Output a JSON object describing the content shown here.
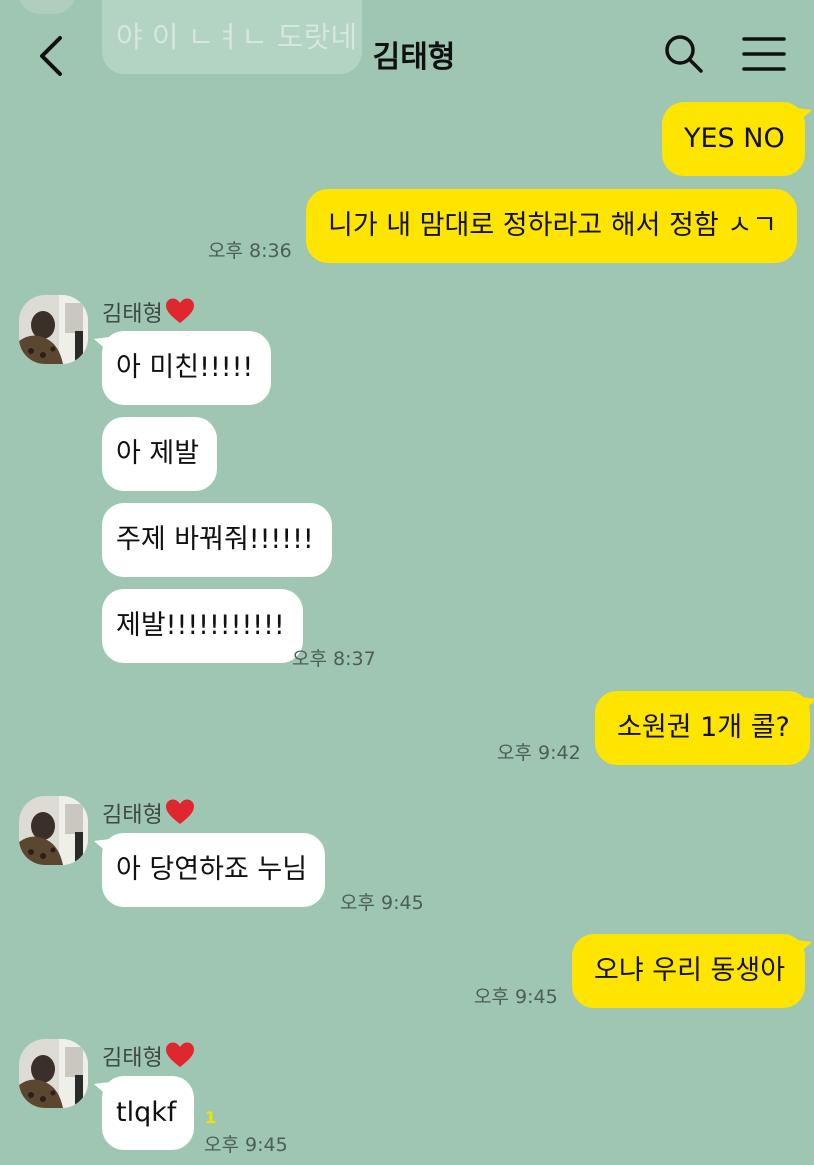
{
  "header": {
    "title": "김태형",
    "back_icon": "chevron-left-icon",
    "search_icon": "search-icon",
    "menu_icon": "menu-icon"
  },
  "previous_message_preview": "야 이 ㄴㅕㄴ 도랏네",
  "contact": {
    "name": "김태형"
  },
  "messages": [
    {
      "from": "me",
      "text": "YES NO"
    },
    {
      "from": "me",
      "text": "니가 내 맘대로 정하라고 해서 정함 ㅅㄱ",
      "time": "오후 8:36"
    },
    {
      "from": "them",
      "text": "아 미친!!!!!"
    },
    {
      "from": "them",
      "text": "아 제발"
    },
    {
      "from": "them",
      "text": "주제 바꿔줘!!!!!!"
    },
    {
      "from": "them",
      "text": "제발!!!!!!!!!!!",
      "time": "오후 8:37"
    },
    {
      "from": "me",
      "text": "소원권 1개 콜?",
      "time": "오후 9:42"
    },
    {
      "from": "them",
      "text": "아 당연하죠 누님",
      "time": "오후 9:45"
    },
    {
      "from": "me",
      "text": "오냐 우리 동생아",
      "time": "오후 9:45"
    },
    {
      "from": "them",
      "text": "tlqkf",
      "time": "오후 9:45",
      "unread": "1"
    }
  ],
  "colors": {
    "background": "#9ec6b2",
    "my_bubble": "#fee500",
    "their_bubble": "#ffffff",
    "heart": "#e0262f"
  }
}
